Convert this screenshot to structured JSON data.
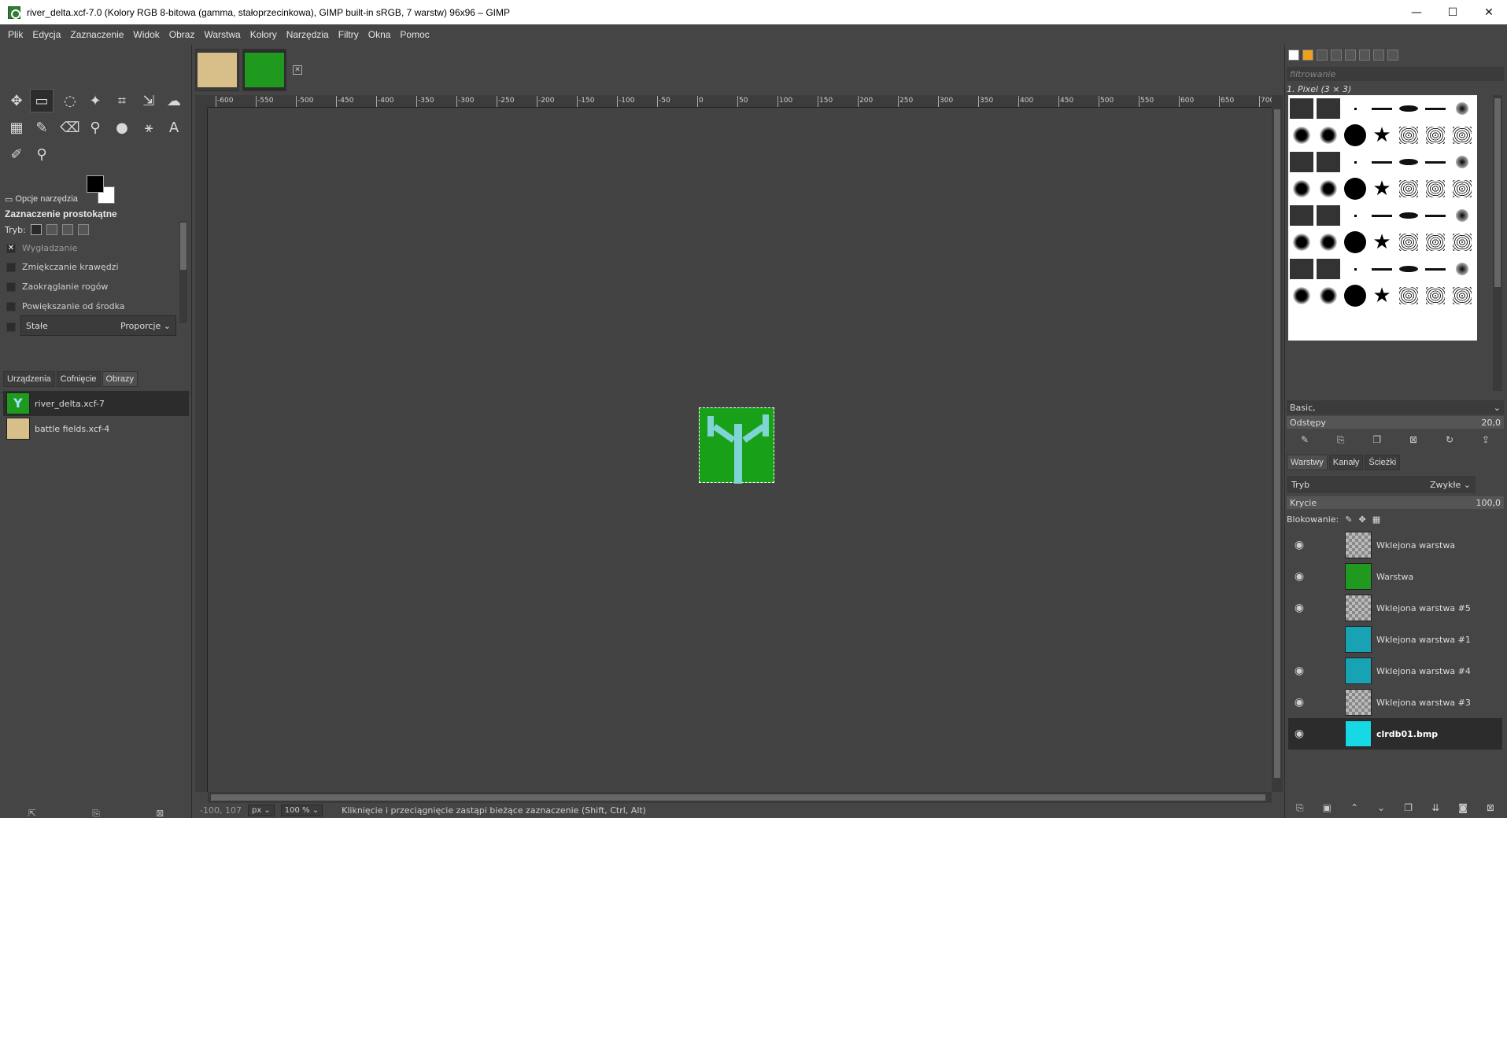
{
  "window": {
    "title": "river_delta.xcf-7.0 (Kolory RGB 8-bitowa (gamma, stałoprzecinkowa), GIMP built-in sRGB, 7 warstw) 96x96 – GIMP",
    "minimize": "—",
    "maximize": "☐",
    "close": "✕"
  },
  "menu": [
    "Plik",
    "Edycja",
    "Zaznaczenie",
    "Widok",
    "Obraz",
    "Warstwa",
    "Kolory",
    "Narzędzia",
    "Filtry",
    "Okna",
    "Pomoc"
  ],
  "tools": [
    {
      "name": "move-tool-icon",
      "glyph": "✥"
    },
    {
      "name": "rect-select-tool-icon",
      "glyph": "▭"
    },
    {
      "name": "lasso-tool-icon",
      "glyph": "◌"
    },
    {
      "name": "fuzzy-select-tool-icon",
      "glyph": "✦"
    },
    {
      "name": "crop-tool-icon",
      "glyph": "⌗"
    },
    {
      "name": "scale-tool-icon",
      "glyph": "⇲"
    },
    {
      "name": "warp-tool-icon",
      "glyph": "☁"
    },
    {
      "name": "gradient-tool-icon",
      "glyph": "▦"
    },
    {
      "name": "paintbrush-tool-icon",
      "glyph": "✎"
    },
    {
      "name": "eraser-tool-icon",
      "glyph": "⌫"
    },
    {
      "name": "clone-tool-icon",
      "glyph": "⚲"
    },
    {
      "name": "smudge-tool-icon",
      "glyph": "●"
    },
    {
      "name": "path-tool-icon",
      "glyph": "⚹"
    },
    {
      "name": "text-tool-icon",
      "glyph": "A"
    },
    {
      "name": "color-picker-tool-icon",
      "glyph": "✐"
    },
    {
      "name": "zoom-tool-icon",
      "glyph": "🔍"
    }
  ],
  "tool_options": {
    "tab_label": "Opcje narzędzia",
    "title": "Zaznaczenie prostokątne",
    "mode_label": "Tryb:",
    "antialias": "Wygładzanie",
    "feather": "Zmiękczanie krawędzi",
    "rounded": "Zaokrąglanie rogów",
    "expand_center": "Powiększanie od środka",
    "fixed": "Stałe",
    "fixed_value": "Proporcje"
  },
  "images_panel": {
    "tabs": [
      "Urządzenia",
      "Cofnięcie",
      "Obrazy"
    ],
    "items": [
      {
        "name": "river_delta.xcf-7",
        "selected": true
      },
      {
        "name": "battle fields.xcf-4",
        "selected": false
      }
    ]
  },
  "ruler": {
    "labels": [
      "-600",
      "-550",
      "-500",
      "-450",
      "-400",
      "-350",
      "-300",
      "-250",
      "-200",
      "-150",
      "-100",
      "-50",
      "0",
      "50",
      "100",
      "150",
      "200",
      "250",
      "300",
      "350",
      "400",
      "450",
      "500",
      "550",
      "600",
      "650",
      "700"
    ]
  },
  "status": {
    "coords": "-100, 107",
    "unit": "px",
    "zoom": "100 %",
    "message": "Kliknięcie i przeciągnięcie zastąpi bieżące zaznaczenie (Shift, Ctrl, Alt)"
  },
  "brushes": {
    "filter_placeholder": "filtrowanie",
    "current": "1. Pixel (3 × 3)",
    "preset": "Basic,",
    "spacing_label": "Odstępy",
    "spacing_value": "20,0"
  },
  "layers_panel": {
    "tabs": [
      "Warstwy",
      "Kanały",
      "Ścieżki"
    ],
    "mode_label": "Tryb",
    "mode_value": "Zwykłe",
    "opacity_label": "Krycie",
    "opacity_value": "100,0",
    "lock_label": "Blokowanie:",
    "layers": [
      {
        "name": "Wklejona warstwa",
        "visible": true,
        "thumb": "checker"
      },
      {
        "name": "Warstwa",
        "visible": true,
        "thumb": "green"
      },
      {
        "name": "Wklejona warstwa #5",
        "visible": true,
        "thumb": "checker"
      },
      {
        "name": "Wklejona warstwa #1",
        "visible": false,
        "thumb": "teal"
      },
      {
        "name": "Wklejona warstwa #4",
        "visible": true,
        "thumb": "teal"
      },
      {
        "name": "Wklejona warstwa #3",
        "visible": true,
        "thumb": "checker"
      },
      {
        "name": "clrdb01.bmp",
        "visible": true,
        "thumb": "cyan",
        "selected": true
      }
    ]
  },
  "colors": {
    "bg_dark": "#454545",
    "image_green": "#19a019",
    "river": "#7fd4d4"
  }
}
